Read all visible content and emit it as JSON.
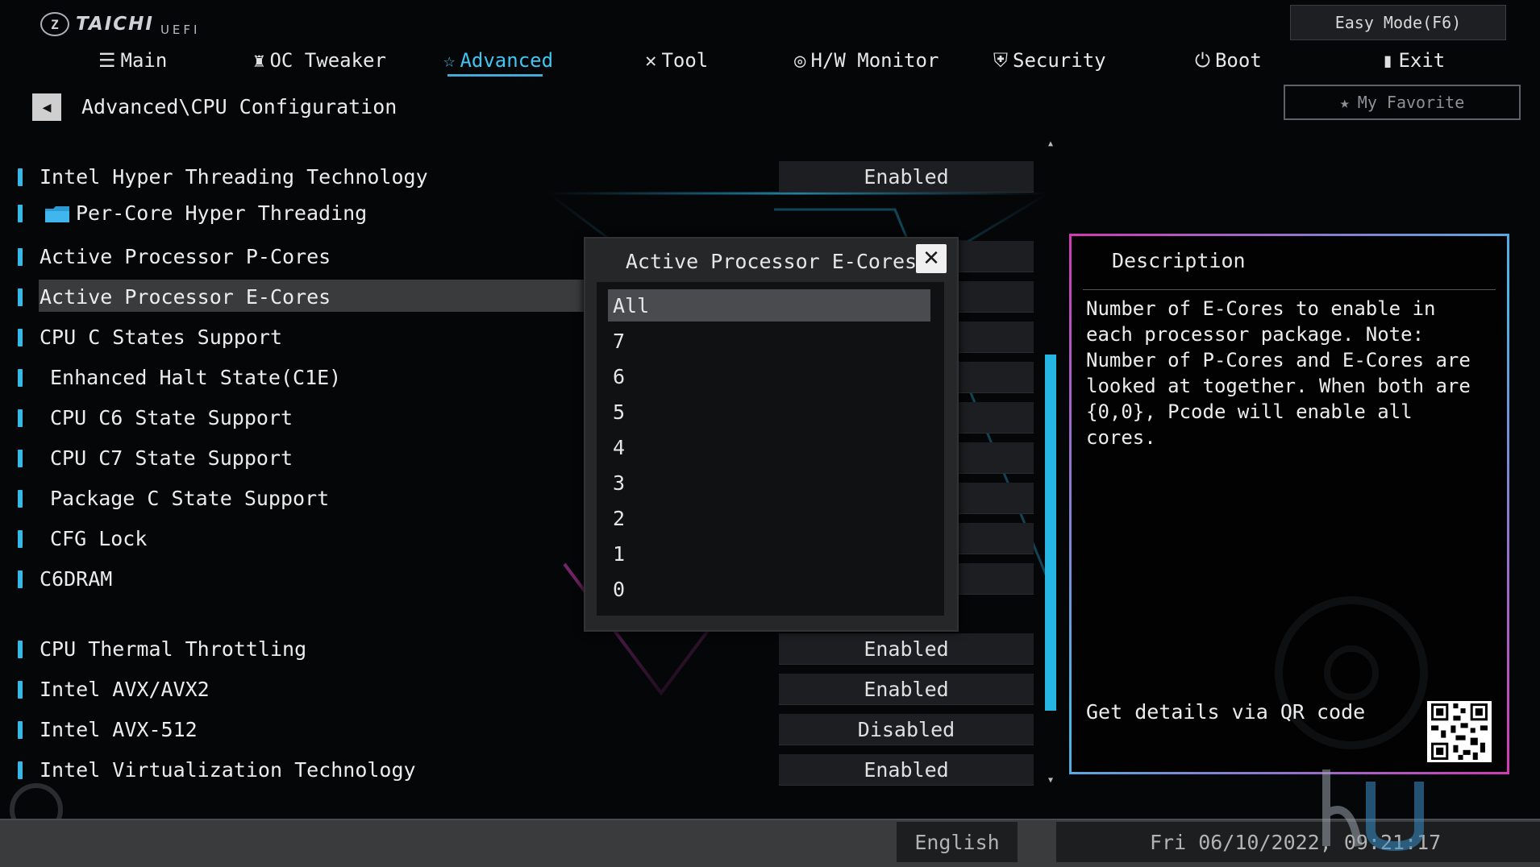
{
  "brand": {
    "name": "TAICHI",
    "sub": "UEFI"
  },
  "easy_mode": "Easy Mode(F6)",
  "my_favorite": "My Favorite",
  "tabs": [
    {
      "label": "Main",
      "icon": "list-icon"
    },
    {
      "label": "OC Tweaker",
      "icon": "rocket-icon"
    },
    {
      "label": "Advanced",
      "icon": "star-icon",
      "active": true
    },
    {
      "label": "Tool",
      "icon": "tools-icon"
    },
    {
      "label": "H/W Monitor",
      "icon": "monitor-gauge-icon"
    },
    {
      "label": "Security",
      "icon": "shield-icon"
    },
    {
      "label": "Boot",
      "icon": "power-icon"
    },
    {
      "label": "Exit",
      "icon": "exit-door-icon"
    }
  ],
  "breadcrumb": "Advanced\\CPU Configuration",
  "settings": [
    {
      "label": "Intel Hyper Threading Technology",
      "value": "Enabled"
    },
    {
      "label": "Per-Core Hyper Threading",
      "value": ""
    },
    {
      "label": "Active Processor P-Cores",
      "value": ""
    },
    {
      "label": "Active Processor E-Cores",
      "value": ""
    },
    {
      "label": "CPU C States Support",
      "value": ""
    },
    {
      "label": "Enhanced Halt State(C1E)",
      "value": ""
    },
    {
      "label": "CPU C6 State Support",
      "value": ""
    },
    {
      "label": "CPU C7 State Support",
      "value": ""
    },
    {
      "label": "Package C State Support",
      "value": ""
    },
    {
      "label": "CFG Lock",
      "value": ""
    },
    {
      "label": "C6DRAM",
      "value": ""
    },
    {
      "label": "CPU Thermal Throttling",
      "value": "Enabled"
    },
    {
      "label": "Intel AVX/AVX2",
      "value": "Enabled"
    },
    {
      "label": "Intel AVX-512",
      "value": "Disabled"
    },
    {
      "label": "Intel Virtualization Technology",
      "value": "Enabled"
    }
  ],
  "popup": {
    "title": "Active Processor E-Cores",
    "close_icon": "close-icon",
    "options": [
      "All",
      "7",
      "6",
      "5",
      "4",
      "3",
      "2",
      "1",
      "0"
    ],
    "selected": "All"
  },
  "description": {
    "title": "Description",
    "text": "Number of E-Cores to enable in each processor package. Note: Number of P-Cores and E-Cores are looked at together. When both are {0,0}, Pcode will enable all cores.",
    "qr_label": "Get details via QR code"
  },
  "footer": {
    "language": "English",
    "datetime": "Fri 06/10/2022, 09:21:17"
  },
  "colors": {
    "accent": "#3fc6f2",
    "scrollbar": "#25b6e4",
    "desc_border_a": "#d13ab5",
    "desc_border_b": "#4ab6e6"
  }
}
